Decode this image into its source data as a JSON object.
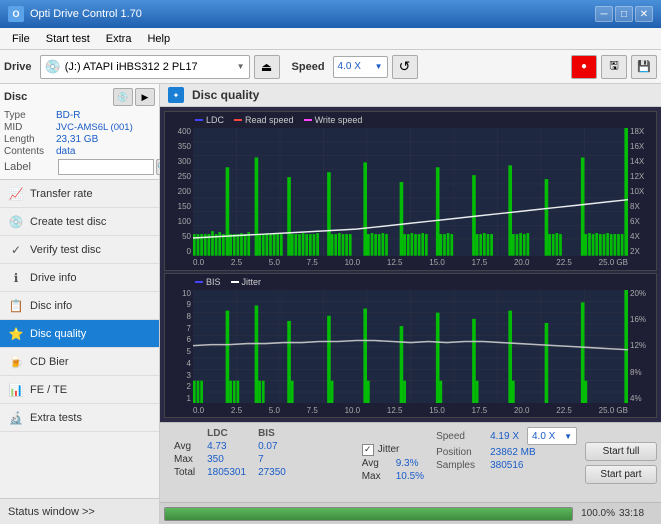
{
  "titlebar": {
    "title": "Opti Drive Control 1.70",
    "icon_text": "O",
    "minimize_label": "─",
    "maximize_label": "□",
    "close_label": "✕"
  },
  "menubar": {
    "items": [
      "File",
      "Start test",
      "Extra",
      "Help"
    ]
  },
  "toolbar": {
    "drive_label": "Drive",
    "drive_icon": "💿",
    "drive_value": "(J:)  ATAPI iHBS312  2 PL17",
    "eject_icon": "⏏",
    "speed_label": "Speed",
    "speed_value": "4.0 X",
    "speed_options": [
      "1.0 X",
      "2.0 X",
      "4.0 X",
      "8.0 X"
    ]
  },
  "sidebar": {
    "disc_section_label": "Disc",
    "disc_type_label": "Type",
    "disc_type_val": "BD-R",
    "disc_mid_label": "MID",
    "disc_mid_val": "JVC-AMS6L (001)",
    "disc_length_label": "Length",
    "disc_length_val": "23,31 GB",
    "disc_contents_label": "Contents",
    "disc_contents_val": "data",
    "disc_label_label": "Label",
    "disc_label_val": "",
    "disc_label_placeholder": "",
    "nav_items": [
      {
        "id": "transfer-rate",
        "label": "Transfer rate",
        "icon": "📈",
        "active": false
      },
      {
        "id": "create-test-disc",
        "label": "Create test disc",
        "icon": "💿",
        "active": false
      },
      {
        "id": "verify-test-disc",
        "label": "Verify test disc",
        "icon": "✓",
        "active": false
      },
      {
        "id": "drive-info",
        "label": "Drive info",
        "icon": "ℹ",
        "active": false
      },
      {
        "id": "disc-info",
        "label": "Disc info",
        "icon": "📋",
        "active": false
      },
      {
        "id": "disc-quality",
        "label": "Disc quality",
        "icon": "⭐",
        "active": true
      },
      {
        "id": "cd-bier",
        "label": "CD Bier",
        "icon": "🍺",
        "active": false
      },
      {
        "id": "fe-te",
        "label": "FE / TE",
        "icon": "📊",
        "active": false
      },
      {
        "id": "extra-tests",
        "label": "Extra tests",
        "icon": "🔬",
        "active": false
      }
    ],
    "status_window_label": "Status window >> "
  },
  "disc_quality": {
    "title": "Disc quality",
    "icon": "✦",
    "chart1": {
      "legend": [
        {
          "label": "LDC",
          "color": "#4444ff"
        },
        {
          "label": "Read speed",
          "color": "#ff4444"
        },
        {
          "label": "Write speed",
          "color": "#ff88ff"
        }
      ],
      "y_labels_left": [
        "400",
        "350",
        "300",
        "250",
        "200",
        "150",
        "100",
        "50",
        "0"
      ],
      "y_labels_right": [
        "18X",
        "16X",
        "14X",
        "12X",
        "10X",
        "8X",
        "6X",
        "4X",
        "2X"
      ],
      "x_labels": [
        "0.0",
        "2.5",
        "5.0",
        "7.5",
        "10.0",
        "12.5",
        "15.0",
        "17.5",
        "20.0",
        "22.5",
        "25.0 GB"
      ]
    },
    "chart2": {
      "legend": [
        {
          "label": "BIS",
          "color": "#4444ff"
        },
        {
          "label": "Jitter",
          "color": "#ffffff"
        }
      ],
      "y_labels_left": [
        "10",
        "9",
        "8",
        "7",
        "6",
        "5",
        "4",
        "3",
        "2",
        "1"
      ],
      "y_labels_right": [
        "20%",
        "16%",
        "12%",
        "8%",
        "4%"
      ],
      "x_labels": [
        "0.0",
        "2.5",
        "5.0",
        "7.5",
        "10.0",
        "12.5",
        "15.0",
        "17.5",
        "20.0",
        "22.5",
        "25.0 GB"
      ]
    }
  },
  "stats": {
    "headers": [
      "",
      "LDC",
      "BIS"
    ],
    "rows": [
      {
        "label": "Avg",
        "ldc": "4.73",
        "bis": "0.07"
      },
      {
        "label": "Max",
        "ldc": "350",
        "bis": "7"
      },
      {
        "label": "Total",
        "ldc": "1805301",
        "bis": "27350"
      }
    ],
    "jitter_label": "Jitter",
    "jitter_avg": "9.3%",
    "jitter_max": "10.5%",
    "jitter_checked": true,
    "speed_label": "Speed",
    "speed_val": "4.19 X",
    "speed_select_val": "4.0 X",
    "position_label": "Position",
    "position_val": "23862 MB",
    "samples_label": "Samples",
    "samples_val": "380516",
    "btn_start_full": "Start full",
    "btn_start_part": "Start part"
  },
  "progressbar": {
    "pct": 100.0,
    "pct_label": "100.0%",
    "time_label": "33:18"
  }
}
